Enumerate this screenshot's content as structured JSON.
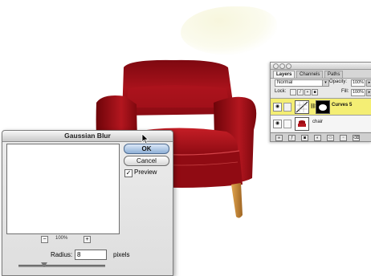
{
  "canvas": {
    "background": "#ffffff",
    "image_subject": "chair"
  },
  "layers_panel": {
    "tabs": [
      "Layers",
      "Channels",
      "Paths"
    ],
    "active_tab": "Layers",
    "blend_mode": "Normal",
    "opacity_label": "Opacity:",
    "opacity_value": "100%",
    "lock_label": "Lock:",
    "fill_label": "Fill:",
    "fill_value": "100%",
    "layers": [
      {
        "name": "Curves 5",
        "selected": true
      },
      {
        "name": "chair",
        "selected": false
      }
    ],
    "selected_color": "#f4ee74"
  },
  "dialog": {
    "title": "Gaussian Blur",
    "ok_label": "OK",
    "cancel_label": "Cancel",
    "preview_label": "Preview",
    "preview_checked": true,
    "zoom_out_symbol": "−",
    "zoom_in_symbol": "+",
    "zoom_level": "100%",
    "radius_label": "Radius:",
    "radius_value": "8",
    "radius_unit": "pixels",
    "radius_slider_fraction": 0.3
  },
  "colors": {
    "chair_red": "#9e0a12",
    "chair_legs": "#c7862e",
    "default_button": "#8fb0d6"
  },
  "icons": [
    "eye-icon",
    "link-icon",
    "lock-icon",
    "arrow-cursor-icon"
  ]
}
